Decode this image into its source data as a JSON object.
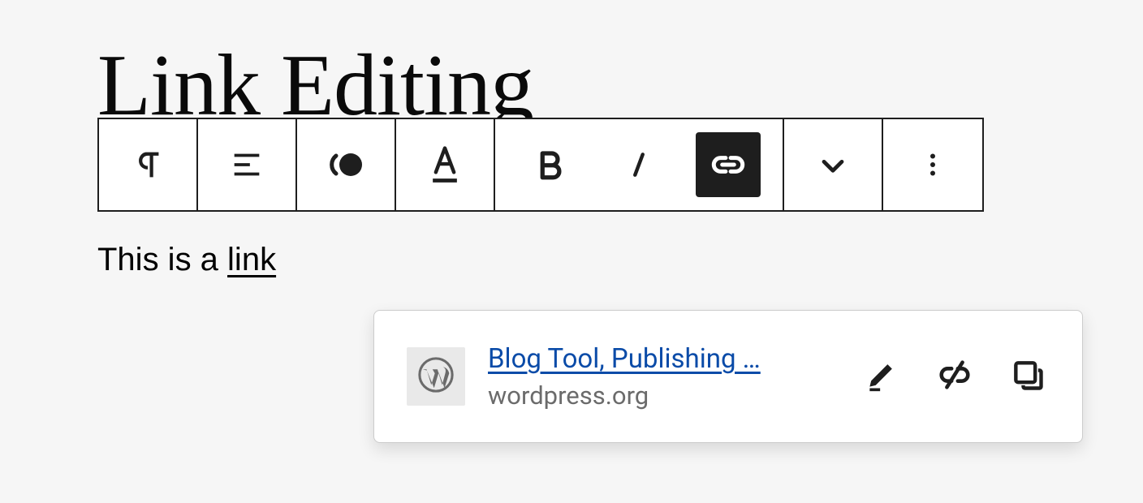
{
  "heading": "Link Editing",
  "paragraph": {
    "prefix": "This is a ",
    "link_text": "link"
  },
  "toolbar": {
    "block_type": "paragraph",
    "align": "left",
    "active_tool": "link"
  },
  "link_popover": {
    "title": "Blog Tool, Publishing …",
    "url": "wordpress.org",
    "favicon_letter": "W"
  }
}
